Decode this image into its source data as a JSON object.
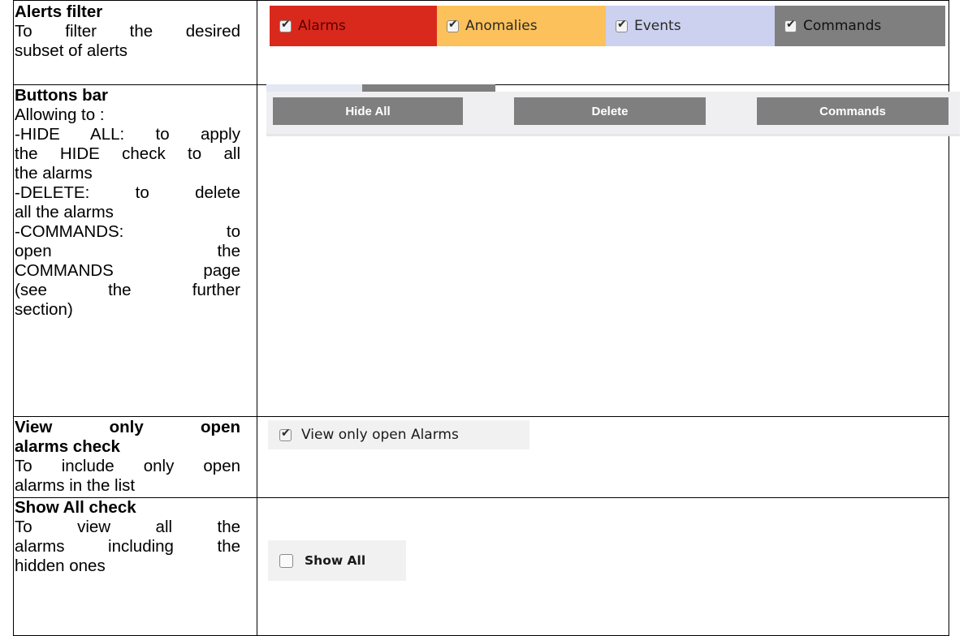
{
  "rows": [
    {
      "title": "Alerts filter",
      "lines": [
        "To filter the desired",
        "subset of alerts"
      ]
    },
    {
      "title": "Buttons bar",
      "lines": [
        "Allowing to :",
        "-HIDE ALL: to apply",
        "the HIDE check to all",
        "the alarms",
        "-DELETE: to delete",
        "all the alarms",
        "-COMMANDS: to",
        "open the",
        "COMMANDS page",
        "(see the further",
        "section)"
      ]
    },
    {
      "title_lines": [
        "View only open",
        "alarms check"
      ],
      "lines": [
        "To include only open",
        "alarms in the list"
      ]
    },
    {
      "title": "Show All check",
      "lines": [
        "To view all the",
        "alarms including the",
        "hidden ones"
      ]
    }
  ],
  "filter_tabs": [
    {
      "label": "Alarms",
      "checked": true,
      "color": "#d9291c"
    },
    {
      "label": "Anomalies",
      "checked": true,
      "color": "#fcc15a"
    },
    {
      "label": "Events",
      "checked": true,
      "color": "#ccd1ef"
    },
    {
      "label": "Commands",
      "checked": true,
      "color": "#7f7f7f"
    }
  ],
  "buttons": {
    "hide_all": "Hide All",
    "delete": "Delete",
    "commands": "Commands"
  },
  "view_only_open": {
    "label": "View only open Alarms",
    "checked": true
  },
  "show_all": {
    "label": "Show All",
    "checked": false
  }
}
